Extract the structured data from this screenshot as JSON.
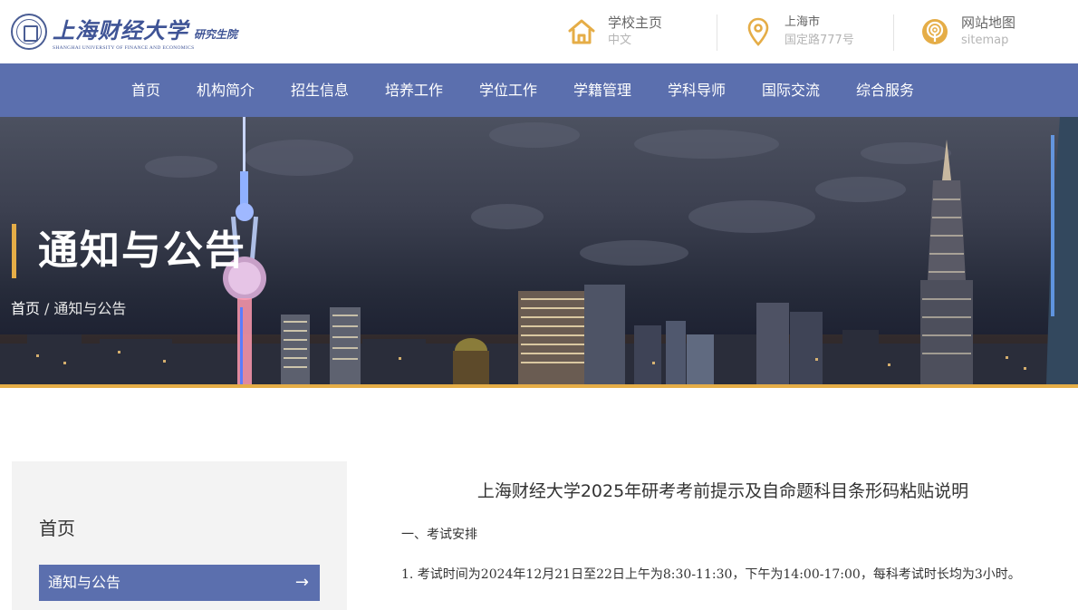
{
  "header": {
    "logo": {
      "cn": "上海财经大学",
      "sub": "研究生院",
      "en": "SHANGHAI UNIVERSITY OF FINANCE AND ECONOMICS"
    },
    "home": {
      "label": "学校主页",
      "sub": "中文",
      "icon": "home-icon"
    },
    "location": {
      "label": "上海市",
      "sub": "国定路777号",
      "icon": "map-pin-icon"
    },
    "sitemap": {
      "label": "网站地图",
      "sub": "sitemap",
      "icon": "sitemap-icon"
    },
    "accent": "#e5ad47"
  },
  "nav": {
    "color": "#5b6fae",
    "items": [
      "首页",
      "机构简介",
      "招生信息",
      "培养工作",
      "学位工作",
      "学籍管理",
      "学科导师",
      "国际交流",
      "综合服务"
    ]
  },
  "banner": {
    "title": "通知与公告",
    "breadcrumb": {
      "home": "首页",
      "sep": "/",
      "current": "通知与公告"
    }
  },
  "sidebar": {
    "heading": "首页",
    "active_item": "通知与公告",
    "arrow": "→"
  },
  "article": {
    "title": "上海财经大学2025年研考考前提示及自命题科目条形码粘贴说明",
    "section1": "一、考试安排",
    "item1": "1. 考试时间为2024年12月21日至22日上午为8:30-11:30，下午为14:00-17:00，每科考试时长均为3小时。"
  }
}
